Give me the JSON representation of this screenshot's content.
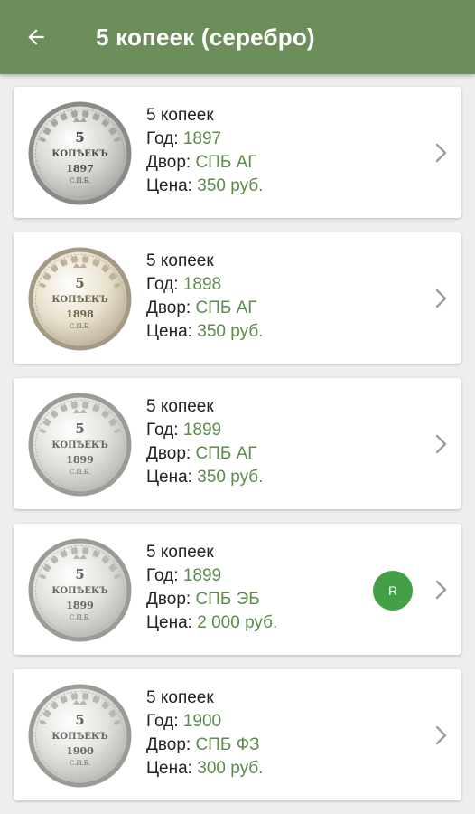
{
  "appbar": {
    "title": "5 копеек (серебро)",
    "back_icon": "arrow-back-icon",
    "color": "#6b8e5a"
  },
  "labels": {
    "year": "Год:",
    "mint": "Двор:",
    "price": "Цена:"
  },
  "coins": [
    {
      "name": "5 копеек",
      "year": "1897",
      "mint": "СПБ АГ",
      "price": "350 руб.",
      "tone": "dark",
      "badge": ""
    },
    {
      "name": "5 копеек",
      "year": "1898",
      "mint": "СПБ АГ",
      "price": "350 руб.",
      "tone": "patina",
      "badge": ""
    },
    {
      "name": "5 копеек",
      "year": "1899",
      "mint": "СПБ АГ",
      "price": "350 руб.",
      "tone": "light",
      "badge": ""
    },
    {
      "name": "5 копеек",
      "year": "1899",
      "mint": "СПБ ЭБ",
      "price": "2 000 руб.",
      "tone": "light",
      "badge": "R"
    },
    {
      "name": "5 копеек",
      "year": "1900",
      "mint": "СПБ ФЗ",
      "price": "300 руб.",
      "tone": "light",
      "badge": ""
    }
  ],
  "colors": {
    "accent_value": "#5e8a4b",
    "badge": "#43a047"
  }
}
